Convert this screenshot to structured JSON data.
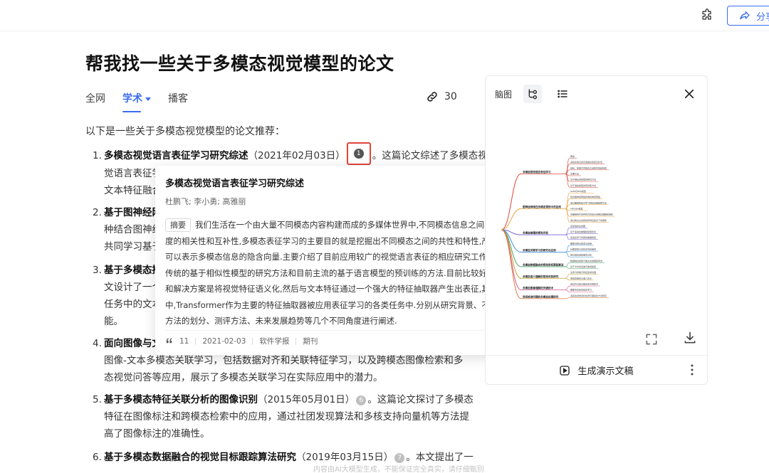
{
  "header": {
    "share_label": "分享"
  },
  "main": {
    "title": "帮我找一些关于多模态视觉模型的论文",
    "tabs": [
      {
        "label": "全网"
      },
      {
        "label": "学术"
      },
      {
        "label": "播客"
      }
    ],
    "ref_count": "30",
    "intro": "以下是一些关于多模态视觉模型的论文推荐：",
    "items": {
      "i1": {
        "num": "1.",
        "bold": "多模态视觉语言表征学习研究综述",
        "date": "（2021年02月03日）",
        "cite": "1",
        "after": "。这篇论文综述了多模态视",
        "l2": "觉语言表征学",
        "l3": "文本特征融合"
      },
      "i2": {
        "num": "2.",
        "bold": "基于图神经网",
        "l2": "种结合图神经",
        "l3": "共同学习基于"
      },
      "i3": {
        "num": "3.",
        "bold": "基于多模态推",
        "l2": "文设计了一个",
        "l3": "任务中的文本",
        "l4": "能。"
      },
      "i4": {
        "num": "4.",
        "bold": "面向图像与文",
        "l2": "图像-文本多模态关联学习，包括数据对齐和关联特征学习，以及跨模态图像检索和多",
        "l3": "态视觉问答等应用，展示了多模态关联学习在实际应用中的潜力。"
      },
      "i5": {
        "num": "5.",
        "bold": "基于多模态特征关联分析的图像识别",
        "date": "（2015年05月01日）",
        "cite": "6",
        "after": "。这篇论文探讨了多模态",
        "l2": "特征在图像标注和跨模态检索中的应用，通过社团发现算法和多核支持向量机等方法提",
        "l3": "高了图像标注的准确性。"
      },
      "i6": {
        "num": "6.",
        "bold": "基于多模态数据融合的视觉目标跟踪算法研究",
        "date": "（2019年03月15日）",
        "cite": "7",
        "after": "。本文提出了一"
      }
    }
  },
  "popover": {
    "title": "多模态视觉语言表征学习研究综述",
    "authors": "杜鹏飞; 李小勇; 高雅丽",
    "abstract_tag": "摘要",
    "abstract_lines": [
      "我们生活在一个由大量不同模态内容构建而成的多媒体世界中,不同模态信息之间具有高",
      "度的相关性和互补性,多模态表征学习的主要目的就是挖掘出不同模态之间的共性和特性,产生出",
      "可以表示多模态信息的隐含向量.主要介绍了目前应用较广的视觉语言表征的相应研究工作,包括",
      "传统的基于相似性模型的研究方法和目前主流的基于语言模型的预训练的方法.目前比较好的思路",
      "和解决方案是将视觉特征语义化,然后与文本特征通过一个强大的特征抽取器产生出表征,其",
      "中,Transformer作为主要的特征抽取器被应用表征学习的各类任务中.分别从研究背景、不同研究",
      "方法的划分、测评方法、未来发展趋势等几个不同角度进行阐述."
    ],
    "citations": "11",
    "date": "2021-02-03",
    "journal": "软件学报",
    "type": "期刊"
  },
  "mindmap_panel": {
    "tab_label": "脑图",
    "generate_label": "生成演示文稿",
    "branches": [
      {
        "label": "多模态视觉语言表征学习",
        "children": [
          "概述",
          "多模态信息的高度相关性和互补性",
          "目标：挖掘不同模态之间的共性和特性",
          "主要方法",
          "基于相似性模型的研究方法",
          "基于语言模型的预训练方法"
        ]
      },
      {
        "label": "图神经网络在多模态视觉中的应用",
        "children": [
          "GNN与BiTe模型",
          "结合图神经网络和卷积神经网络",
          "通过图结构和可学习特征向量提取节点",
          "MRGNN模型",
          "在图结构中多种形式的信息间相互理解和组织",
          "通过信息主动层动作特征集合下的更新"
        ]
      },
      {
        "label": "多模态推理的视觉问答",
        "children": [
          "自然语言生成器",
          "基于多模态推理和模型优化",
          "自适应学习问题的推理模型"
        ]
      },
      {
        "label": "多模态关联学习的研究与应用",
        "children": [
          "图像识别与检索与应用",
          "社团发现与多核支持向量机",
          "通过语言感知量性分析"
        ]
      },
      {
        "label": "多模态数据融合的视觉目标跟踪算法",
        "children": [
          "数据融合模型与相关滤波跟踪算法",
          "基于卡尔曼滤波与重叠模型"
        ]
      },
      {
        "label": "多模态语义理解的视觉问答研究",
        "children": [
          "注意力机制与特征集成基础",
          "多模态融合与语义表示"
        ]
      },
      {
        "label": "多模态图像理解的关键技术",
        "children": [
          "通过并与知识融合的关键技术",
          "图像协作和多模态学习"
        ]
      },
      {
        "label": "目标检测问题的多模态处理研究",
        "children": [
          "多模态视觉目标检测与跟踪的方法研究"
        ]
      }
    ]
  },
  "footer": {
    "note": "内容由AI大模型生成，不能保证完全真实，请仔细甄别"
  },
  "colors": {
    "accent": "#3a6df0",
    "highlight_box": "#e0463a"
  }
}
